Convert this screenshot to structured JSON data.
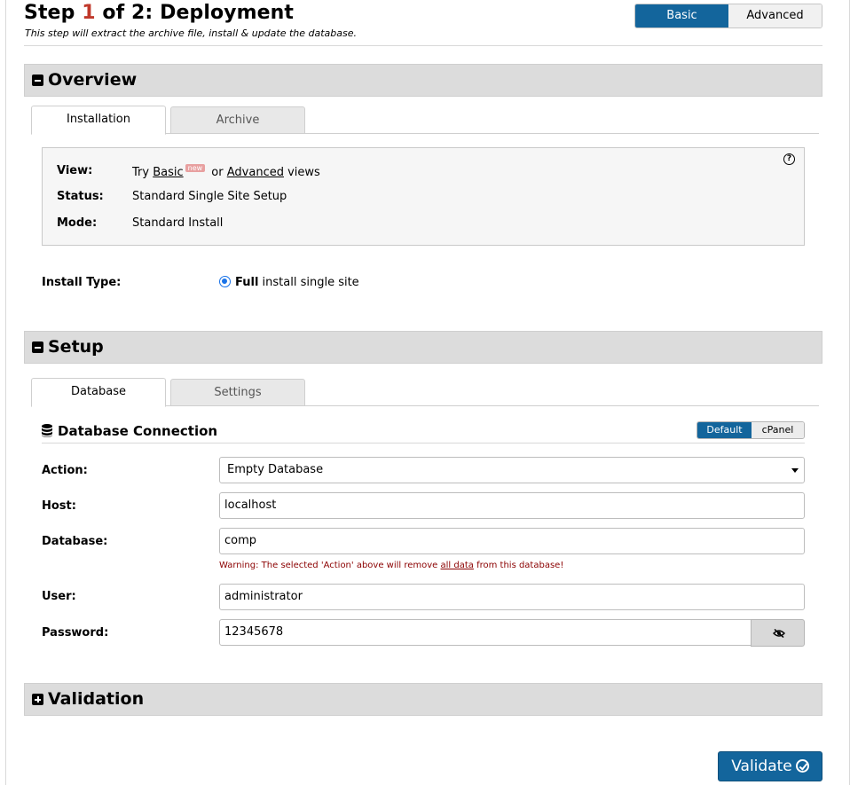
{
  "header": {
    "title_prefix": "Step ",
    "title_step": "1",
    "title_suffix": " of 2: Deployment",
    "subtitle": "This step will extract the archive file, install & update the database.",
    "view_toggle": {
      "basic": "Basic",
      "advanced": "Advanced",
      "selected": "Basic"
    }
  },
  "overview": {
    "heading": "Overview",
    "tabs": [
      {
        "label": "Installation",
        "active": true
      },
      {
        "label": "Archive",
        "active": false
      }
    ],
    "info": {
      "view_label": "View:",
      "view_try": "Try ",
      "view_basic": "Basic",
      "view_badge": "new",
      "view_or": " or ",
      "view_advanced": "Advanced",
      "view_views": " views",
      "status_label": "Status:",
      "status_value": "Standard Single Site Setup",
      "mode_label": "Mode:",
      "mode_value": "Standard Install",
      "help_glyph": "?"
    },
    "install_type": {
      "label": "Install Type:",
      "option_bold": "Full",
      "option_rest": " install single site",
      "selected": true
    }
  },
  "setup": {
    "heading": "Setup",
    "tabs": [
      {
        "label": "Database",
        "active": true
      },
      {
        "label": "Settings",
        "active": false
      }
    ],
    "db_connection": {
      "title": "Database Connection",
      "toggle": {
        "default": "Default",
        "cpanel": "cPanel",
        "selected": "Default"
      },
      "action_label": "Action:",
      "action_value": "Empty Database",
      "host_label": "Host:",
      "host_value": "localhost",
      "database_label": "Database:",
      "database_value": "comp",
      "warning_pre": "Warning: The selected 'Action' above will remove ",
      "warning_link": "all data",
      "warning_post": " from this database!",
      "user_label": "User:",
      "user_value": "administrator",
      "password_label": "Password:",
      "password_value": "12345678"
    }
  },
  "validation": {
    "heading": "Validation"
  },
  "footer": {
    "validate_label": "Validate"
  },
  "colors": {
    "primary": "#13659c",
    "step_number": "#c0392b",
    "warning": "#8b0000",
    "section_bg": "#dcdcdc"
  }
}
